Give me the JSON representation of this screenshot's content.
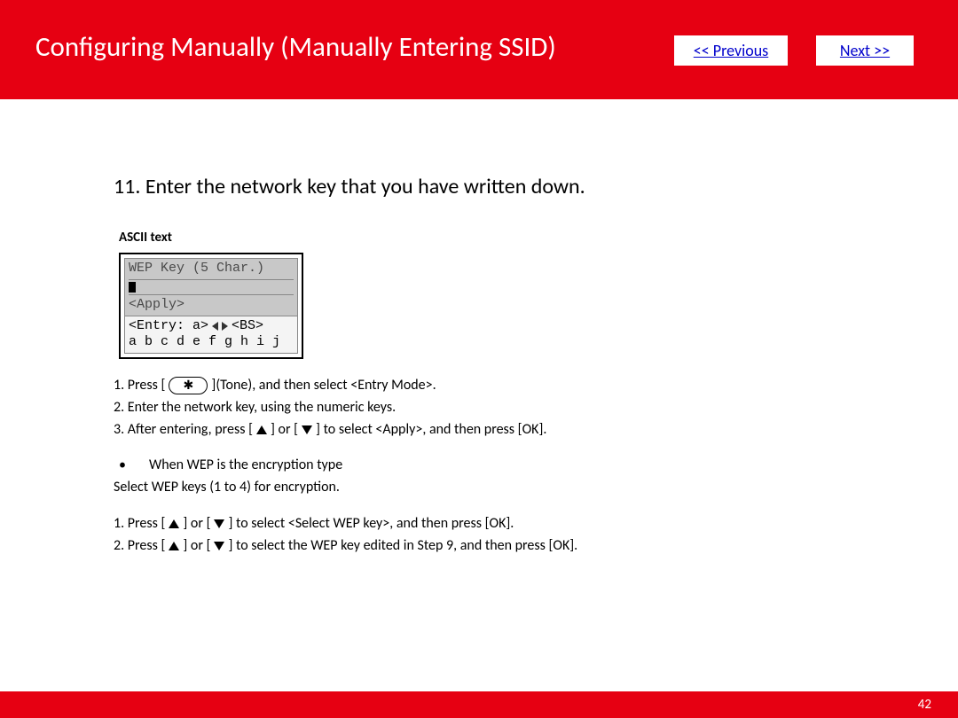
{
  "header": {
    "title": "Configuring Manually (Manually Entering SSID)",
    "prev_label": "<< Previous",
    "next_label": "Next >>"
  },
  "step": {
    "heading": "11. Enter the network key that you have written down.",
    "sub_label": "ASCII text"
  },
  "lcd": {
    "line1": "WEP Key (5 Char.)",
    "apply": "<Apply>",
    "entry": "<Entry: a>",
    "bs": "<BS>",
    "chars": "a b c d e f g h i j"
  },
  "instr": {
    "l1a": "1. Press [",
    "l1b": "](Tone), and then select <Entry Mode>.",
    "l2": "2. Enter the network key, using the numeric keys.",
    "l3a": "3. After entering, press [",
    "l3b": "] or [",
    "l3c": "] to select <Apply>, and then press [OK].",
    "wep_title": "When WEP is the encryption type",
    "wep_sub": "Select WEP keys (1 to 4) for encryption.",
    "w1a": "1. Press [",
    "w1b": "] or [",
    "w1c": "] to select <Select WEP key>, and then press [OK].",
    "w2a": "2. Press [",
    "w2b": "] or [",
    "w2c": "] to select the WEP key edited in Step 9, and then press [OK]."
  },
  "footer": {
    "page": "42"
  }
}
